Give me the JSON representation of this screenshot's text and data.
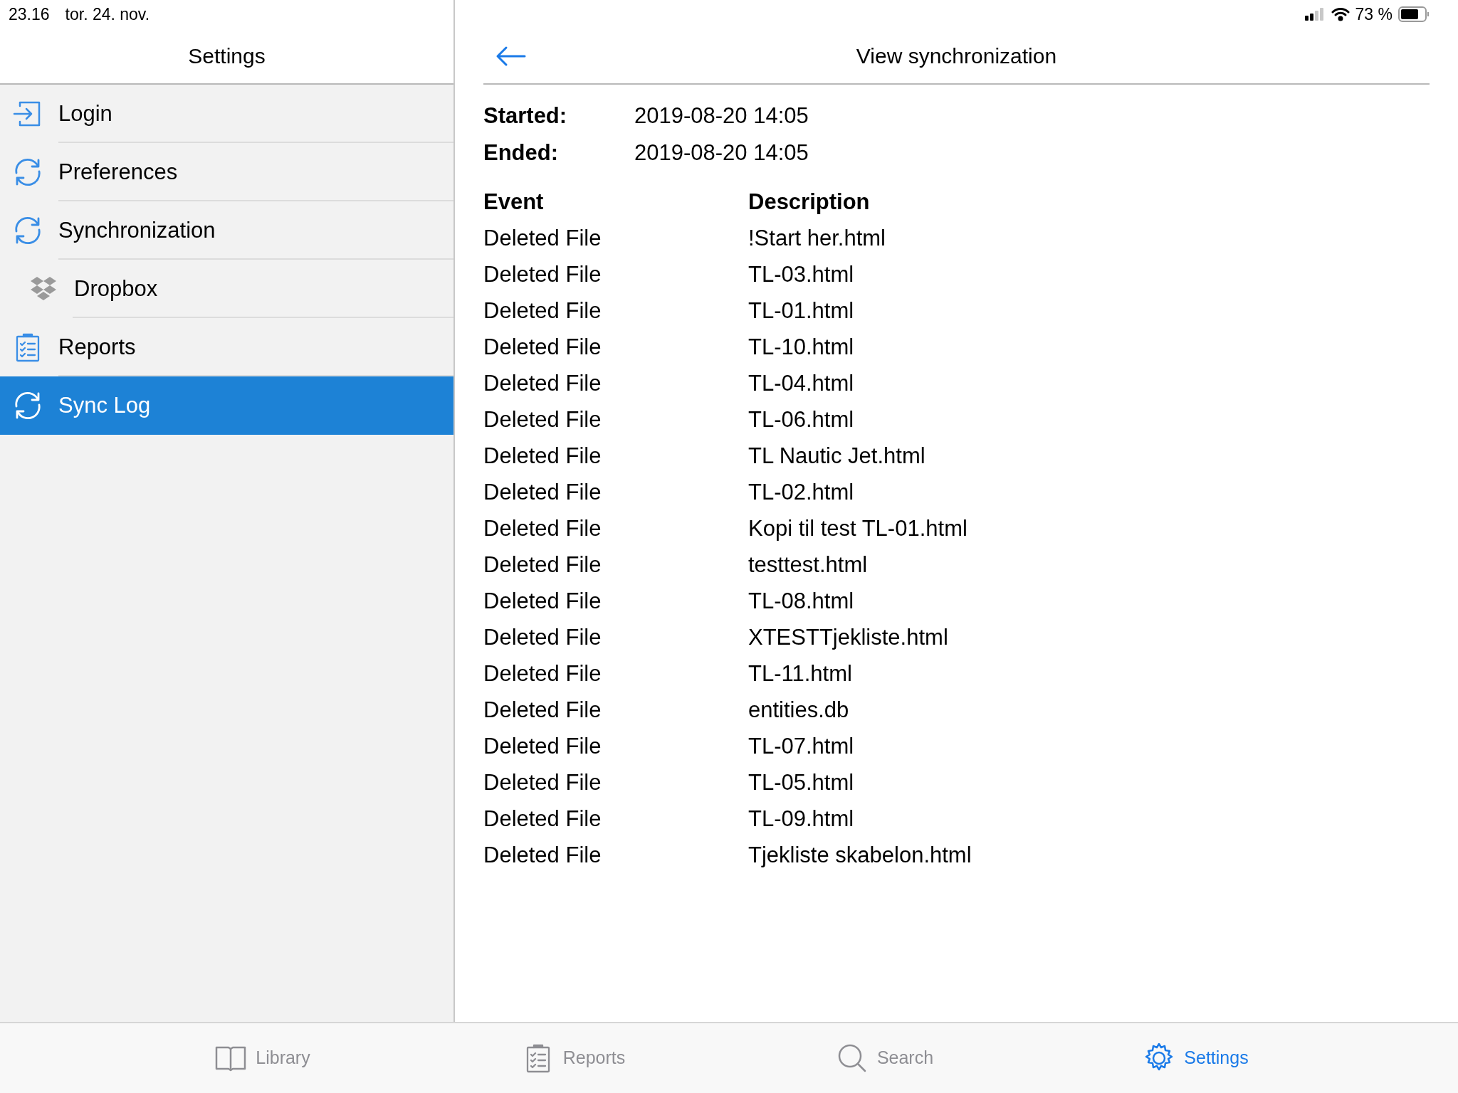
{
  "status_bar": {
    "time": "23.16",
    "date": "tor. 24. nov.",
    "battery": "73 %"
  },
  "sidebar": {
    "title": "Settings",
    "items": [
      {
        "label": "Login",
        "kind": "login",
        "selected": false
      },
      {
        "label": "Preferences",
        "kind": "sync",
        "selected": false
      },
      {
        "label": "Synchronization",
        "kind": "sync",
        "selected": false,
        "children": [
          {
            "label": "Dropbox",
            "kind": "dropbox",
            "selected": false
          }
        ]
      },
      {
        "label": "Reports",
        "kind": "reports",
        "selected": false
      },
      {
        "label": "Sync Log",
        "kind": "sync",
        "selected": true
      }
    ]
  },
  "detail": {
    "title": "View synchronization",
    "summary": [
      {
        "label": "Started:",
        "value": "2019-08-20 14:05"
      },
      {
        "label": "Ended:",
        "value": "2019-08-20 14:05"
      }
    ],
    "table": {
      "columns": [
        "Event",
        "Description"
      ],
      "rows": [
        [
          "Deleted File",
          "!Start her.html"
        ],
        [
          "Deleted File",
          "TL-03.html"
        ],
        [
          "Deleted File",
          "TL-01.html"
        ],
        [
          "Deleted File",
          "TL-10.html"
        ],
        [
          "Deleted File",
          "TL-04.html"
        ],
        [
          "Deleted File",
          "TL-06.html"
        ],
        [
          "Deleted File",
          "TL Nautic Jet.html"
        ],
        [
          "Deleted File",
          "TL-02.html"
        ],
        [
          "Deleted File",
          "Kopi til test TL-01.html"
        ],
        [
          "Deleted File",
          "testtest.html"
        ],
        [
          "Deleted File",
          "TL-08.html"
        ],
        [
          "Deleted File",
          "XTESTTjekliste.html"
        ],
        [
          "Deleted File",
          "TL-11.html"
        ],
        [
          "Deleted File",
          "entities.db"
        ],
        [
          "Deleted File",
          "TL-07.html"
        ],
        [
          "Deleted File",
          "TL-05.html"
        ],
        [
          "Deleted File",
          "TL-09.html"
        ],
        [
          "Deleted File",
          "Tjekliste skabelon.html"
        ]
      ]
    }
  },
  "tab_bar": [
    {
      "label": "Library",
      "kind": "book",
      "selected": false
    },
    {
      "label": "Reports",
      "kind": "reports",
      "selected": false
    },
    {
      "label": "Search",
      "kind": "search",
      "selected": false
    },
    {
      "label": "Settings",
      "kind": "gear",
      "selected": true
    }
  ]
}
